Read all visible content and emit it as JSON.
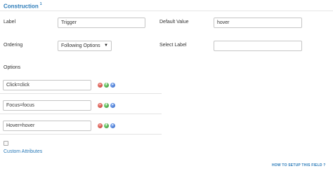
{
  "section": {
    "title": "Construction",
    "superscript": "1"
  },
  "label": {
    "caption": "Label",
    "value": "Trigger"
  },
  "default_value": {
    "caption": "Default Value",
    "value": "hover"
  },
  "ordering": {
    "caption": "Ordering",
    "selected": "Following Options",
    "caret": "▼"
  },
  "select_label": {
    "caption": "Select Label",
    "value": ""
  },
  "options": {
    "caption": "Options",
    "items": [
      {
        "value": "Click=click"
      },
      {
        "value": "Focus=focus"
      },
      {
        "value": "Hover=hover"
      }
    ],
    "button_icons": {
      "remove": "remove-icon",
      "add": "add-icon",
      "order": "reorder-icon"
    },
    "colors": {
      "remove": "#d9534f",
      "add": "#3fa33f",
      "order": "#3d74d4"
    }
  },
  "custom_attributes": {
    "label": "Custom Attributes",
    "checked": false
  },
  "help_link": "HOW TO SETUP THIS FIELD ?",
  "colors": {
    "accent": "#2a7ab8"
  }
}
